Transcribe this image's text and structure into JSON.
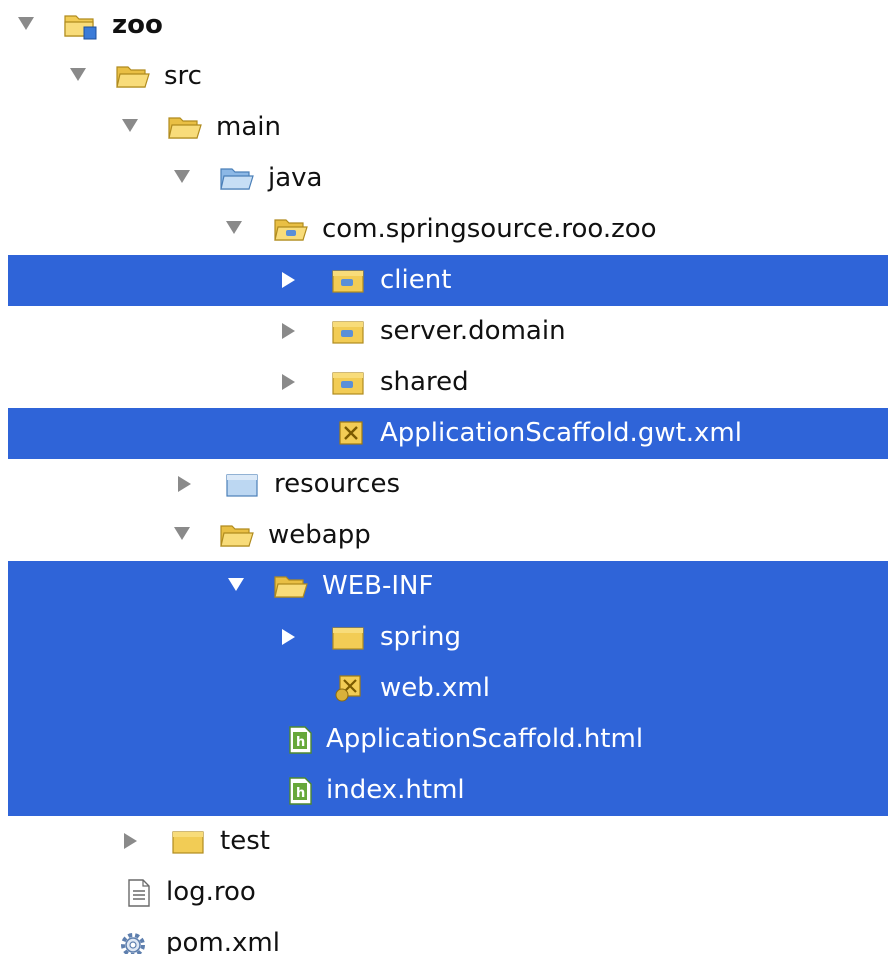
{
  "project_tree": {
    "root_label": "zoo",
    "src_label": "src",
    "main_label": "main",
    "java_label": "java",
    "package_label": "com.springsource.roo.zoo",
    "client_label": "client",
    "server_domain_label": "server.domain",
    "shared_label": "shared",
    "gwt_xml_label": "ApplicationScaffold.gwt.xml",
    "resources_label": "resources",
    "webapp_label": "webapp",
    "web_inf_label": "WEB-INF",
    "spring_label": "spring",
    "web_xml_label": "web.xml",
    "app_html_label": "ApplicationScaffold.html",
    "index_html_label": "index.html",
    "test_label": "test",
    "log_roo_label": "log.roo",
    "pom_label": "pom.xml"
  },
  "colors": {
    "selection": "#2f64d8",
    "twisty": "#8a8a8a",
    "folder": "#f2cc55"
  },
  "icons": [
    "project-folder-icon",
    "folder-icon",
    "source-folder-icon",
    "package-icon",
    "xml-file-icon",
    "html-file-icon",
    "text-file-icon",
    "gear-icon"
  ]
}
